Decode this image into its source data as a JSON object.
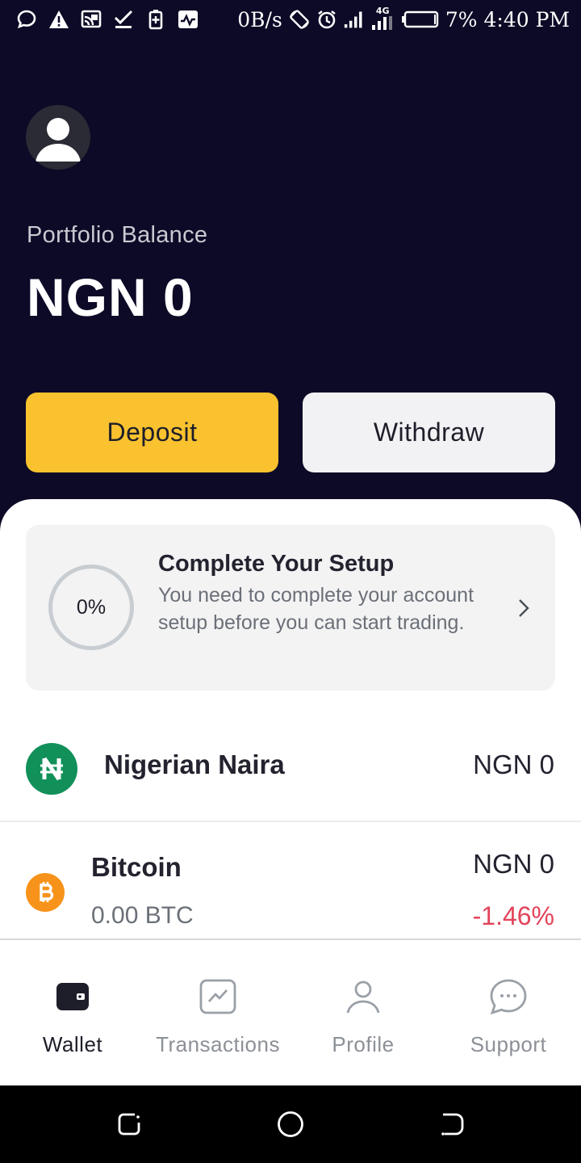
{
  "status_bar": {
    "net_speed": "0B/s",
    "network_type": "4G",
    "battery": "7%",
    "time": "4:40 PM",
    "icons": [
      "chat-bubble-icon",
      "warning-icon",
      "cast-icon",
      "download-done-icon",
      "battery-saver-icon",
      "activity-icon",
      "rotate-icon",
      "alarm-icon",
      "signal-icon",
      "signal-4g-icon",
      "battery-icon"
    ]
  },
  "header": {
    "portfolio_label": "Portfolio Balance",
    "balance": "NGN 0",
    "deposit_label": "Deposit",
    "withdraw_label": "Withdraw"
  },
  "setup": {
    "progress": "0%",
    "progress_value": 0,
    "title": "Complete Your Setup",
    "description": "You need to complete your account setup before you can start trading."
  },
  "assets": [
    {
      "name": "Nigerian Naira",
      "value": "NGN 0",
      "icon": "naira-icon"
    },
    {
      "name": "Bitcoin",
      "amount": "0.00 BTC",
      "value": "NGN 0",
      "change": "-1.46%",
      "icon": "bitcoin-icon"
    }
  ],
  "nav": [
    {
      "label": "Wallet",
      "icon": "wallet-icon",
      "active": true
    },
    {
      "label": "Transactions",
      "icon": "transactions-icon",
      "active": false
    },
    {
      "label": "Profile",
      "icon": "profile-icon",
      "active": false
    },
    {
      "label": "Support",
      "icon": "support-icon",
      "active": false
    }
  ],
  "colors": {
    "header_bg": "#0c0a26",
    "deposit_bg": "#f9c22e",
    "naira_green": "#11905a",
    "bitcoin_orange": "#f7931a",
    "negative": "#e2435a"
  }
}
